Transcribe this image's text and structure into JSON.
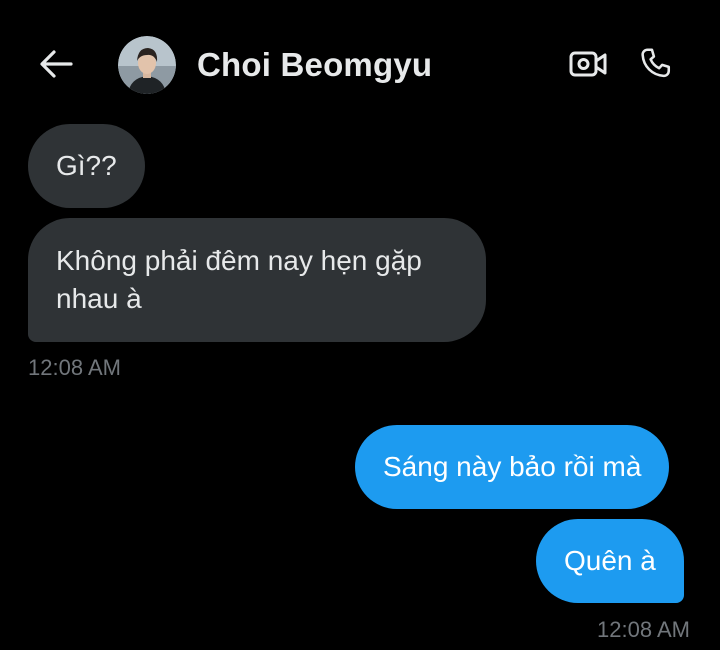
{
  "header": {
    "back_icon": "arrow-left-icon",
    "contact_name": "Choi Beomgyu",
    "video_icon": "video-camera-icon",
    "call_icon": "phone-icon"
  },
  "messages": [
    {
      "direction": "incoming",
      "text": "Gì??"
    },
    {
      "direction": "incoming",
      "text": "Không phải đêm nay hẹn gặp nhau à"
    },
    {
      "direction": "outgoing",
      "text": "Sáng này bảo rồi mà"
    },
    {
      "direction": "outgoing",
      "text": "Quên à"
    }
  ],
  "timestamps": {
    "incoming_group": "12:08 AM",
    "outgoing_group": "12:08 AM"
  },
  "colors": {
    "background": "#000000",
    "incoming_bubble": "#2f3336",
    "outgoing_bubble": "#1d9bf0",
    "text_primary": "#e7e9ea",
    "text_secondary": "#71767b"
  }
}
